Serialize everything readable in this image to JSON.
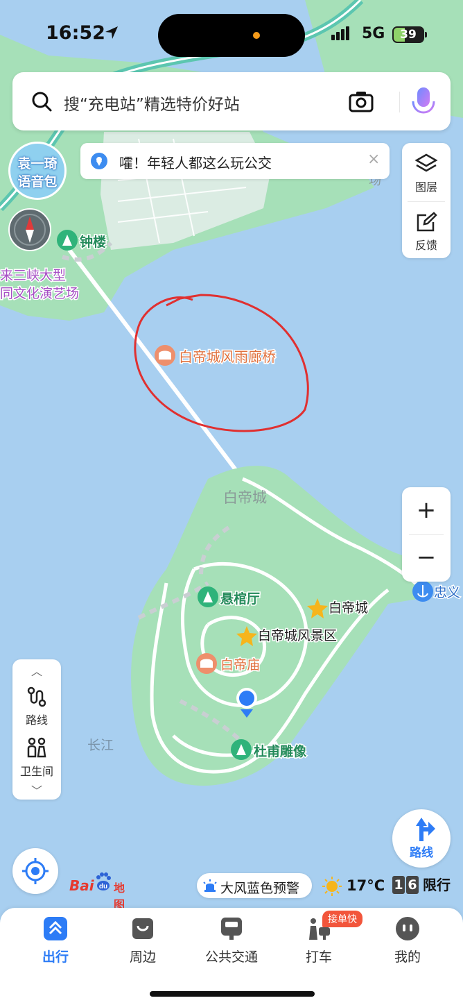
{
  "status_bar": {
    "time": "16:52",
    "network": "5G",
    "battery": "39"
  },
  "search": {
    "placeholder": "搜“充电站”精选特价好站"
  },
  "voice_badge": {
    "line1": "袁一琦",
    "line2": "语音包"
  },
  "notice": {
    "text": "嚯！年轻人都这么玩公交",
    "close": "×"
  },
  "side_panel": {
    "layers": "图层",
    "feedback": "反馈"
  },
  "zoom": {
    "in": "+",
    "out": "−"
  },
  "tools": {
    "route": "路线",
    "toilet": "卫生间"
  },
  "route_fab": {
    "label": "路线"
  },
  "map": {
    "pois": {
      "bell_tower": "钟楼",
      "theatre_line1": "来三峡大型",
      "theatre_line2": "同文化演艺场",
      "bridge": "白帝城风雨廊桥",
      "baidi_area": "白帝城",
      "xuanguan": "悬棺厅",
      "baidi_city": "白帝城",
      "scenic_area": "白帝城风景区",
      "temple": "白帝庙",
      "dufu": "杜甫雕像",
      "river": "长江",
      "zhongyi": "忠义",
      "corner": "场"
    },
    "colors": {
      "water": "#a8cff0",
      "land": "#a6e0b8",
      "road": "#ffffff",
      "annotation": "#e03030"
    }
  },
  "logo": {
    "bai": "Bai",
    "du": "du",
    "tu": "地图"
  },
  "warning": {
    "text": "大风蓝色预警"
  },
  "weather": {
    "temp": "17°C"
  },
  "restriction": {
    "digit1": "1",
    "digit2": "6",
    "label": "限行"
  },
  "tabs": [
    {
      "label": "出行",
      "icon": "travel-icon",
      "active": true
    },
    {
      "label": "周边",
      "icon": "nearby-icon"
    },
    {
      "label": "公共交通",
      "icon": "bus-icon"
    },
    {
      "label": "打车",
      "icon": "taxi-icon",
      "badge": "接单快"
    },
    {
      "label": "我的",
      "icon": "profile-icon"
    }
  ]
}
